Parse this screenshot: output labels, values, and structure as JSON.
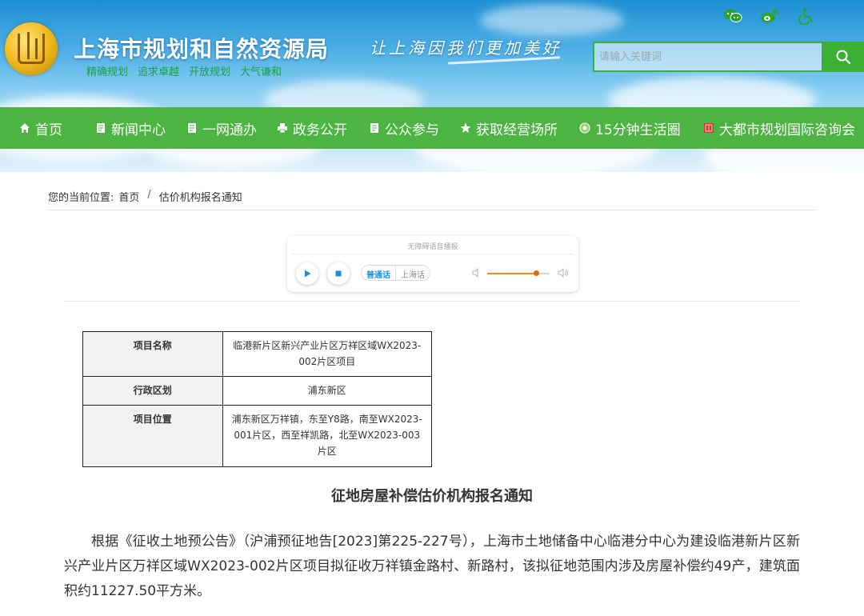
{
  "header": {
    "site_title": "上海市规划和自然资源局",
    "slogans": [
      "精确规划",
      "追求卓越",
      "开放规划",
      "大气谦和"
    ],
    "motto": "让上海因我们更加美好",
    "icons": [
      "wechat-icon",
      "weibo-icon",
      "accessibility-icon"
    ],
    "accent_color": "#4cb541"
  },
  "search": {
    "placeholder": "请输入关键词",
    "value": ""
  },
  "nav": {
    "items": [
      {
        "label": "首页",
        "icon": "home-icon"
      },
      {
        "label": "新闻中心",
        "icon": "document-icon"
      },
      {
        "label": "一网通办",
        "icon": "document-icon"
      },
      {
        "label": "政务公开",
        "icon": "printer-icon"
      },
      {
        "label": "公众参与",
        "icon": "document-icon"
      },
      {
        "label": "获取经营场所",
        "icon": "star-icon"
      },
      {
        "label": "15分钟生活圈",
        "icon": "circle-logo-icon"
      },
      {
        "label": "大都市规划国际咨询会",
        "icon": "seal-icon"
      }
    ]
  },
  "breadcrumb": {
    "prefix": "您的当前位置:",
    "home": "首页",
    "separator": "/",
    "current": "估价机构报名通知"
  },
  "player": {
    "title": "无障碍语音播报",
    "lang_active": "普通话",
    "lang_inactive": "上海话",
    "volume_level": 0.78
  },
  "info_table": {
    "rows": [
      {
        "label": "项目名称",
        "value": "临港新片区新兴产业片区万祥区域WX2023-002片区项目"
      },
      {
        "label": "行政区划",
        "value": "浦东新区"
      },
      {
        "label": "项目位置",
        "value": "浦东新区万祥镇，东至Y8路，南至WX2023-001片区，西至祥凯路，北至WX2023-003片区"
      }
    ]
  },
  "article": {
    "title": "征地房屋补偿估价机构报名通知",
    "body": "根据《征收土地预公告》（沪浦预征地告[2023]第225-227号），上海市土地储备中心临港分中心为建设临港新片区新兴产业片区万祥区域WX2023-002片区项目拟征收万祥镇金路村、新路村，该拟征地范围内涉及房屋补偿约49产，建筑面积约11227.50平方米。"
  }
}
